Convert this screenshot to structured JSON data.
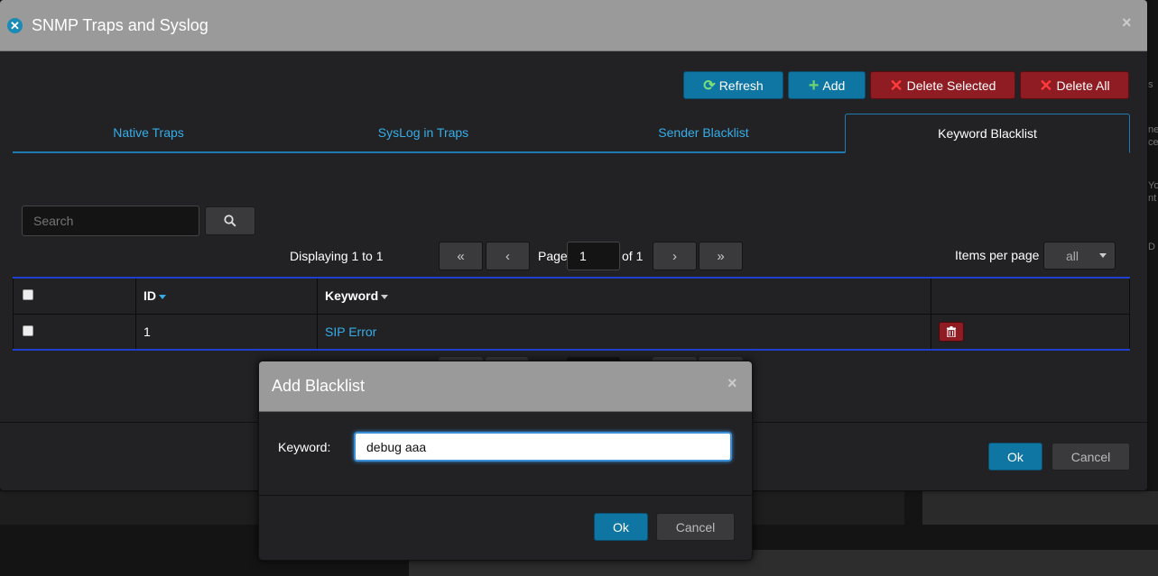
{
  "window": {
    "title": "SNMP Traps and Syslog",
    "close_glyph": "×"
  },
  "toolbar": {
    "refresh_label": "Refresh",
    "add_label": "Add",
    "delete_selected_label": "Delete Selected",
    "delete_all_label": "Delete All"
  },
  "tabs": [
    {
      "label": "Native Traps",
      "active": false
    },
    {
      "label": "SysLog in Traps",
      "active": false
    },
    {
      "label": "Sender Blacklist",
      "active": false
    },
    {
      "label": "Keyword Blacklist",
      "active": true
    }
  ],
  "search": {
    "placeholder": "Search"
  },
  "pagination": {
    "displaying": "Displaying 1 to 1",
    "page_label": "Page",
    "page_value": "1",
    "of_label": "of 1",
    "first": "«",
    "prev": "‹",
    "next": "›",
    "last": "»"
  },
  "items_per_page": {
    "label": "Items per page",
    "value": "all"
  },
  "table": {
    "columns": [
      "",
      "ID",
      "Keyword",
      ""
    ],
    "rows": [
      {
        "id": "1",
        "keyword": "SIP Error"
      }
    ]
  },
  "footer": {
    "ok_label": "Ok",
    "cancel_label": "Cancel"
  },
  "add_dialog": {
    "title": "Add Blacklist",
    "keyword_label": "Keyword:",
    "keyword_value": "debug aaa",
    "ok_label": "Ok",
    "cancel_label": "Cancel",
    "close_glyph": "×"
  },
  "background": {
    "edge_fragments": [
      "s",
      "ne",
      "ce",
      "Yo",
      "nt",
      "D"
    ]
  },
  "colors": {
    "accent_blue": "#0f76a3",
    "link_blue": "#35aee8",
    "danger_red": "#8e1c22",
    "header_gray": "#9a9a9a",
    "table_border_blue": "#1e3fd0"
  }
}
